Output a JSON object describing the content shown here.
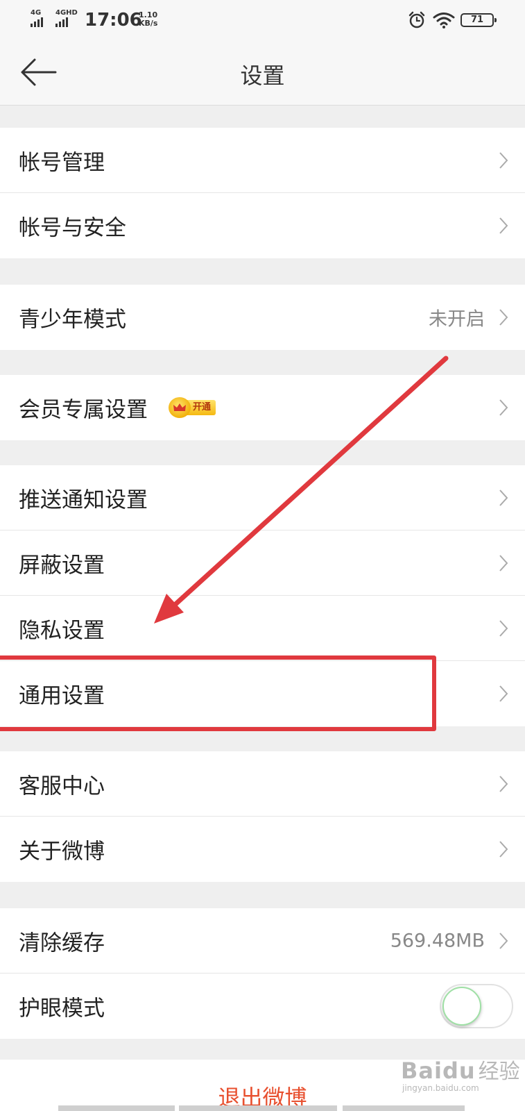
{
  "status_bar": {
    "signal1_label": "4G",
    "signal2_label": "4GHD",
    "time": "17:06",
    "speed_value": "1.10",
    "speed_unit": "KB/s",
    "battery": "71"
  },
  "header": {
    "title": "设置",
    "back_icon": "arrow-left-icon"
  },
  "groups": [
    {
      "items": [
        {
          "label": "帐号管理"
        },
        {
          "label": "帐号与安全"
        }
      ]
    },
    {
      "items": [
        {
          "label": "青少年模式",
          "value": "未开启"
        }
      ]
    },
    {
      "items": [
        {
          "label": "会员专属设置",
          "badge": "开通"
        }
      ]
    },
    {
      "items": [
        {
          "label": "推送通知设置"
        },
        {
          "label": "屏蔽设置"
        },
        {
          "label": "隐私设置"
        },
        {
          "label": "通用设置"
        }
      ]
    },
    {
      "items": [
        {
          "label": "客服中心"
        },
        {
          "label": "关于微博"
        }
      ]
    },
    {
      "items": [
        {
          "label": "清除缓存",
          "value": "569.48MB"
        },
        {
          "label": "护眼模式",
          "toggle_on": false
        }
      ]
    }
  ],
  "logout": {
    "label": "退出微博"
  },
  "watermark": {
    "brand": "Bai",
    "brand_suffix": "du",
    "cn": "经验",
    "url": "jingyan.baidu.com"
  },
  "colors": {
    "accent": "#e8502f",
    "annotation": "#e0393e",
    "background": "#efefef"
  }
}
